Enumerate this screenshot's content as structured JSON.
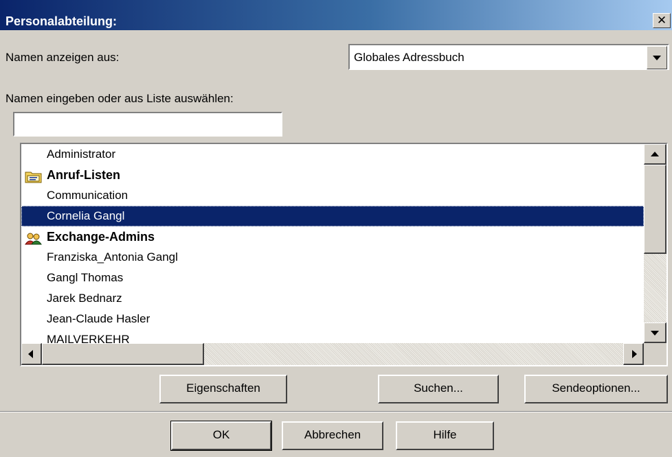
{
  "window": {
    "title": "Personalabteilung:",
    "close_glyph": "✕"
  },
  "show_names": {
    "label": "Namen anzeigen aus:",
    "selected": "Globales Adressbuch"
  },
  "search": {
    "label": "Namen eingeben oder aus Liste auswählen:",
    "value": ""
  },
  "list": {
    "items": [
      {
        "label": "Administrator",
        "bold": false,
        "icon": null
      },
      {
        "label": "Anruf-Listen",
        "bold": true,
        "icon": "folder-icon"
      },
      {
        "label": "Communication",
        "bold": false,
        "icon": null
      },
      {
        "label": "Cornelia Gangl",
        "bold": false,
        "icon": null,
        "selected": true
      },
      {
        "label": "Exchange-Admins",
        "bold": true,
        "icon": "distribution-list-icon"
      },
      {
        "label": "Franziska_Antonia Gangl",
        "bold": false,
        "icon": null
      },
      {
        "label": "Gangl Thomas",
        "bold": false,
        "icon": null
      },
      {
        "label": "Jarek Bednarz",
        "bold": false,
        "icon": null
      },
      {
        "label": "Jean-Claude Hasler",
        "bold": false,
        "icon": null
      },
      {
        "label": "MAILVERKEHR",
        "bold": false,
        "icon": null
      }
    ]
  },
  "actions": {
    "properties": "Eigenschaften",
    "find": "Suchen...",
    "send_options": "Sendeoptionen..."
  },
  "footer": {
    "ok": "OK",
    "cancel": "Abbrechen",
    "help": "Hilfe"
  }
}
